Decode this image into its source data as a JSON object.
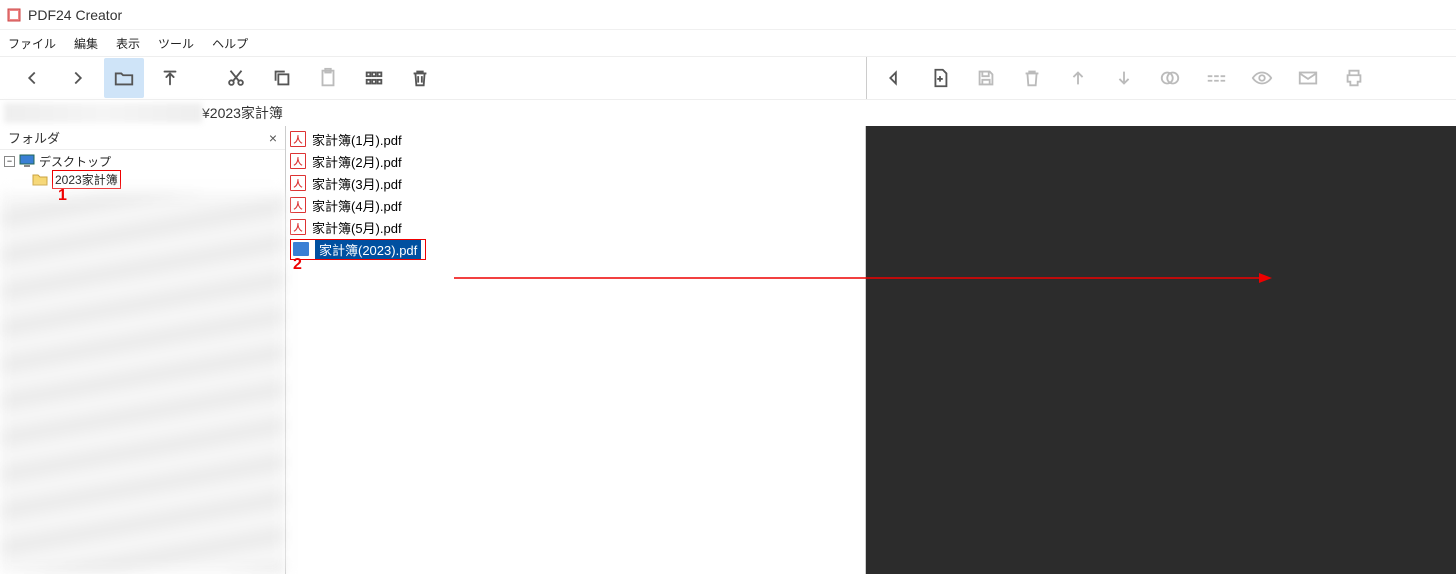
{
  "titlebar": {
    "title": "PDF24 Creator"
  },
  "menu": {
    "file": "ファイル",
    "edit": "編集",
    "view": "表示",
    "tools": "ツール",
    "help": "ヘルプ"
  },
  "pathbar": {
    "path": "¥2023家計簿"
  },
  "sidebar": {
    "header": "フォルダ",
    "close": "×",
    "root": "デスクトップ",
    "folder": "2023家計簿"
  },
  "files": [
    "家計簿(1月).pdf",
    "家計簿(2月).pdf",
    "家計簿(3月).pdf",
    "家計簿(4月).pdf",
    "家計簿(5月).pdf"
  ],
  "selected_file": "家計簿(2023).pdf",
  "annotations": {
    "n1": "1",
    "n2": "2"
  },
  "icons": {
    "pdf_glyph": "人"
  }
}
